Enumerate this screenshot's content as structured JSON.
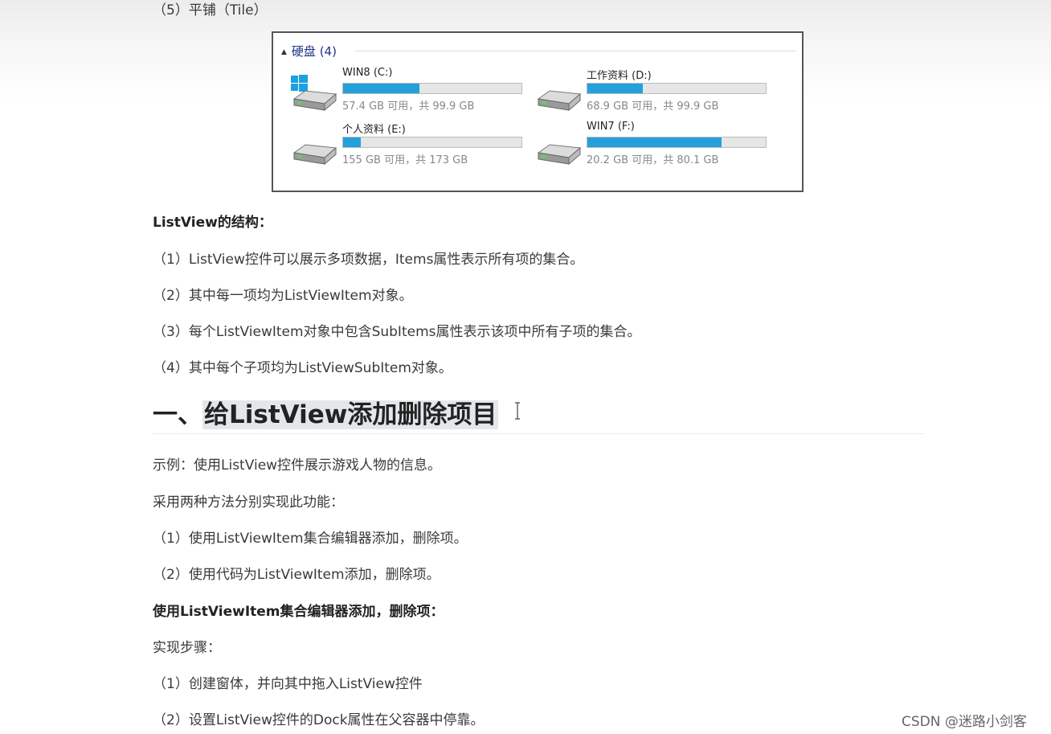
{
  "top_item": "（5）平铺（Tile）",
  "figure": {
    "group_label": "硬盘 (4)",
    "drives": [
      {
        "name": "WIN8 (C:)",
        "info": "57.4 GB 可用，共 99.9 GB",
        "used_fraction": 0.43,
        "icon": "windows-drive-icon"
      },
      {
        "name": "工作资料 (D:)",
        "info": "68.9 GB 可用，共 99.9 GB",
        "used_fraction": 0.31,
        "icon": "hard-drive-icon"
      },
      {
        "name": "个人资料 (E:)",
        "info": "155 GB 可用，共 173 GB",
        "used_fraction": 0.1,
        "icon": "hard-drive-icon"
      },
      {
        "name": "WIN7 (F:)",
        "info": "20.2 GB 可用，共 80.1 GB",
        "used_fraction": 0.75,
        "icon": "hard-drive-icon"
      }
    ],
    "bar_color": "#26a0da"
  },
  "structure": {
    "title": "ListView的结构：",
    "items": [
      "（1）ListView控件可以展示多项数据，Items属性表示所有项的集合。",
      "（2）其中每一项均为ListViewItem对象。",
      "（3）每个ListViewItem对象中包含SubItems属性表示该项中所有子项的集合。",
      "（4）其中每个子项均为ListViewSubItem对象。"
    ]
  },
  "heading": {
    "prefix": "一、",
    "text": "给ListView添加删除项目"
  },
  "example": "示例：使用ListView控件展示游戏人物的信息。",
  "methods_intro": "采用两种方法分别实现此功能：",
  "methods": [
    "（1）使用ListViewItem集合编辑器添加，删除项。",
    "（2）使用代码为ListViewItem添加，删除项。"
  ],
  "subheading": "使用ListViewItem集合编辑器添加，删除项：",
  "steps_intro": "实现步骤：",
  "steps": [
    "（1）创建窗体，并向其中拖入ListView控件",
    "（2）设置ListView控件的Dock属性在父容器中停靠。"
  ],
  "watermark": "CSDN @迷路小剑客"
}
